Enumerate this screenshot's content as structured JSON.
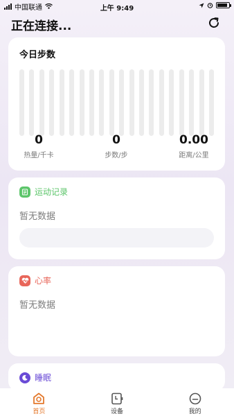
{
  "status_bar": {
    "carrier": "中国联通",
    "time": "上午 9:49"
  },
  "header": {
    "title": "正在连接...",
    "refresh_icon": "refresh-icon"
  },
  "steps_card": {
    "title": "今日步数",
    "bar_count": 20,
    "metrics": [
      {
        "value": "0",
        "label": "热量/千卡"
      },
      {
        "value": "0",
        "label": "步数/步"
      },
      {
        "value": "0.00",
        "label": "距离/公里"
      }
    ]
  },
  "exercise_card": {
    "title": "运动记录",
    "empty_text": "暂无数据",
    "icon": "note-icon",
    "color": "#5cc56a"
  },
  "heart_card": {
    "title": "心率",
    "empty_text": "暂无数据",
    "icon": "heart-icon",
    "color": "#e8665a"
  },
  "sleep_card": {
    "title": "睡眠",
    "icon": "moon-icon",
    "color": "#6a4bd6"
  },
  "tabbar": {
    "items": [
      {
        "label": "首页",
        "icon": "home-icon",
        "active": true
      },
      {
        "label": "设备",
        "icon": "device-icon",
        "active": false
      },
      {
        "label": "我的",
        "icon": "profile-icon",
        "active": false
      }
    ],
    "active_color": "#e47a2e"
  }
}
